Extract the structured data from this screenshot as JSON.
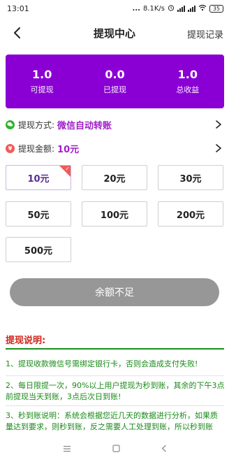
{
  "status_bar": {
    "time": "13:01",
    "dots": "...",
    "speed": "8.1K/s",
    "battery": "35"
  },
  "nav": {
    "title": "提现中心",
    "record_label": "提现记录"
  },
  "summary": {
    "bg_color": "#8a00d4",
    "stats": [
      {
        "value": "1.0",
        "label": "可提现"
      },
      {
        "value": "0.0",
        "label": "已提现"
      },
      {
        "value": "1.0",
        "label": "总收益"
      }
    ]
  },
  "method": {
    "label": "提现方式:",
    "value": "微信自动转账",
    "icon": "wechat-icon",
    "icon_color": "#2bb32b",
    "value_color": "#a020c8"
  },
  "amount": {
    "label": "提现金额:",
    "value": "10元",
    "icon": "yen-icon",
    "icon_color": "#ef5b5b",
    "value_color": "#a020c8"
  },
  "amount_options": [
    {
      "label": "10元",
      "selected": true
    },
    {
      "label": "20元",
      "selected": false
    },
    {
      "label": "30元",
      "selected": false
    },
    {
      "label": "50元",
      "selected": false
    },
    {
      "label": "100元",
      "selected": false
    },
    {
      "label": "200元",
      "selected": false
    },
    {
      "label": "500元",
      "selected": false
    }
  ],
  "withdraw_button": {
    "label": "余额不足"
  },
  "explanation": {
    "title": "提现说明:",
    "items": [
      "1、提现收款微信号需绑定银行卡，否则会造成支付失败!",
      "2、每日限提一次，90%以上用户提现为秒到账，其余的下午3点前提现当天到账，3点后次日到账!",
      "3、秒到账说明：系统会根据您近几天的数据进行分析，如果质量达到要求，则秒到账，反之需要人工处理到账，所以秒到账"
    ]
  }
}
